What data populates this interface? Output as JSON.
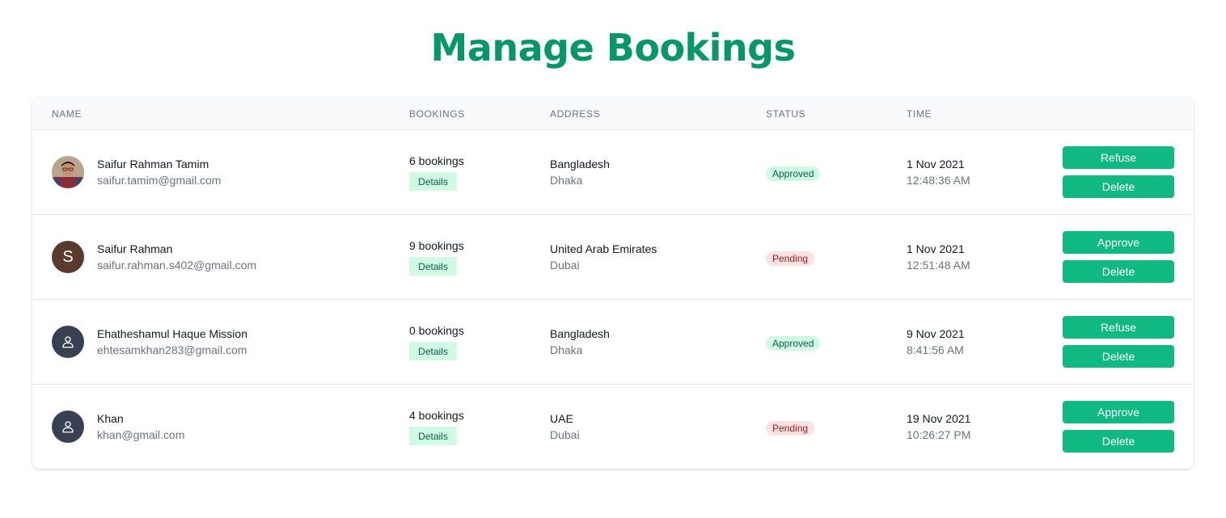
{
  "page": {
    "title": "Manage Bookings"
  },
  "colors": {
    "title": "#059669",
    "button": "#10b981",
    "approved_bg": "#d1fae5",
    "pending_bg": "#fee2e2",
    "avatar_generic": "#374151"
  },
  "table": {
    "headers": {
      "name": "NAME",
      "bookings": "BOOKINGS",
      "address": "ADDRESS",
      "status": "STATUS",
      "time": "TIME"
    },
    "rows": [
      {
        "avatar": {
          "type": "photo",
          "icon": "user-photo"
        },
        "name": "Saifur Rahman Tamim",
        "email": "saifur.tamim@gmail.com",
        "bookings": "6 bookings",
        "details_label": "Details",
        "country": "Bangladesh",
        "city": "Dhaka",
        "status": "Approved",
        "date": "1 Nov 2021",
        "time": "12:48:36 AM",
        "primary_action": "Refuse",
        "delete_label": "Delete"
      },
      {
        "avatar": {
          "type": "letter",
          "letter": "S"
        },
        "name": "Saifur Rahman",
        "email": "saifur.rahman.s402@gmail.com",
        "bookings": "9 bookings",
        "details_label": "Details",
        "country": "United Arab Emirates",
        "city": "Dubai",
        "status": "Pending",
        "date": "1 Nov 2021",
        "time": "12:51:48 AM",
        "primary_action": "Approve",
        "delete_label": "Delete"
      },
      {
        "avatar": {
          "type": "generic",
          "icon": "user-icon"
        },
        "name": "Ehatheshamul Haque Mission",
        "email": "ehtesamkhan283@gmail.com",
        "bookings": "0 bookings",
        "details_label": "Details",
        "country": "Bangladesh",
        "city": "Dhaka",
        "status": "Approved",
        "date": "9 Nov 2021",
        "time": "8:41:56 AM",
        "primary_action": "Refuse",
        "delete_label": "Delete"
      },
      {
        "avatar": {
          "type": "generic",
          "icon": "user-icon"
        },
        "name": "Khan",
        "email": "khan@gmail.com",
        "bookings": "4 bookings",
        "details_label": "Details",
        "country": "UAE",
        "city": "Dubai",
        "status": "Pending",
        "date": "19 Nov 2021",
        "time": "10:26:27 PM",
        "primary_action": "Approve",
        "delete_label": "Delete"
      }
    ]
  }
}
